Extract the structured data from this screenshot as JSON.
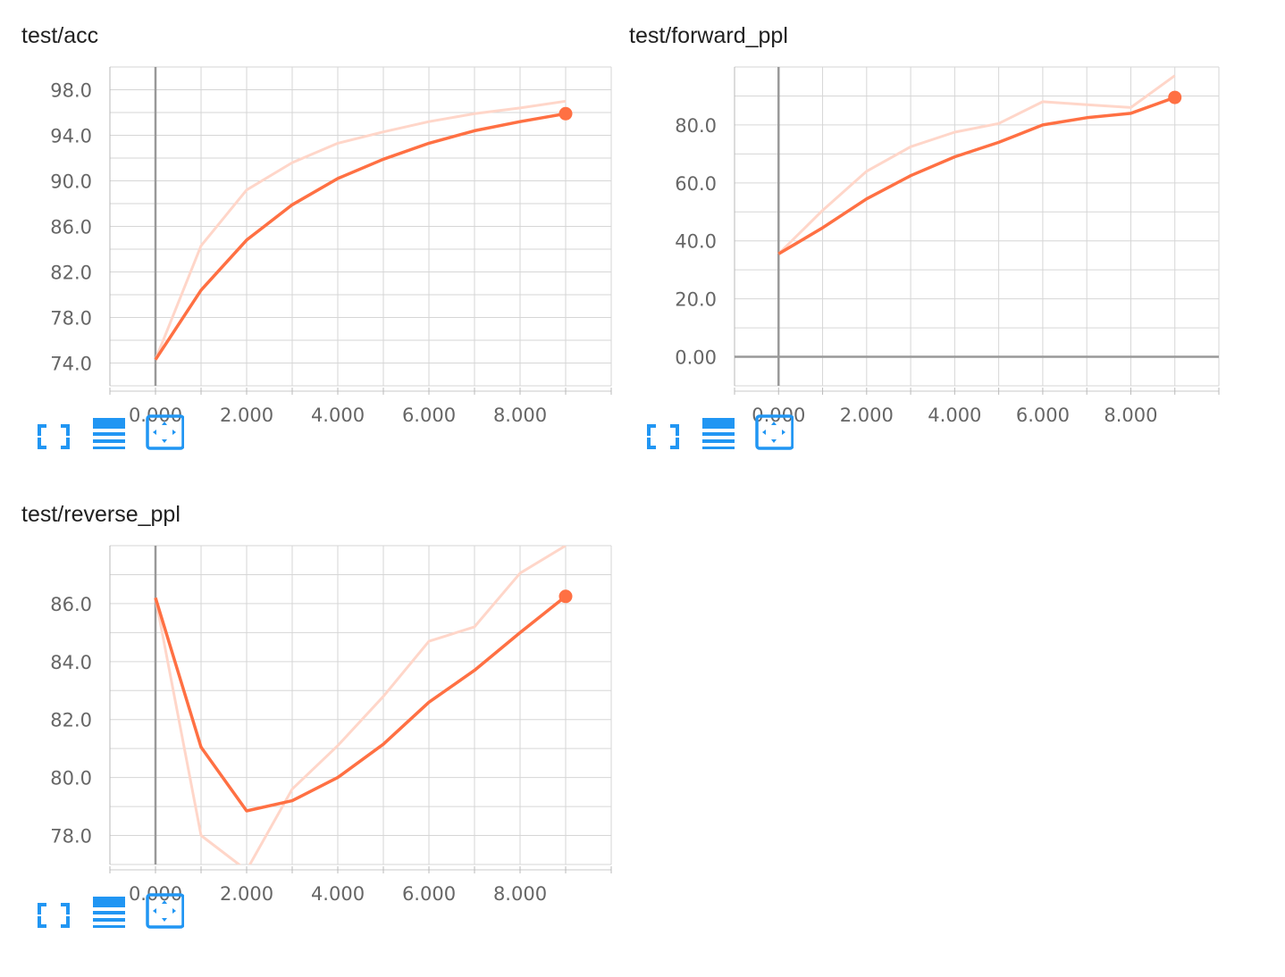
{
  "colors": {
    "line": "#ff7043",
    "line_raw": "#ffd6c9",
    "grid": "#d6d6d6",
    "axis": "#999999",
    "tick_text": "#666666",
    "toolbar_icon": "#2196f3"
  },
  "toolbar_icons": [
    "fullscreen-icon",
    "data-table-icon",
    "fit-domain-icon"
  ],
  "charts": [
    {
      "title": "test/acc",
      "chart_data": {
        "type": "line",
        "title": "test/acc",
        "x_ticks": [
          "0.000",
          "2.000",
          "4.000",
          "6.000",
          "8.000"
        ],
        "y_ticks": [
          "74.0",
          "78.0",
          "82.0",
          "86.0",
          "90.0",
          "94.0",
          "98.0"
        ],
        "xlim": [
          -1,
          10
        ],
        "ylim": [
          72,
          100
        ],
        "series": [
          {
            "values_x": [
              0,
              1,
              2,
              3,
              4,
              5,
              6,
              7,
              8,
              9
            ],
            "values": [
              74.3,
              80.4,
              84.8,
              87.9,
              90.2,
              91.9,
              93.3,
              94.4,
              95.2,
              95.9
            ]
          },
          {
            "values_x": [
              0,
              1,
              2,
              3,
              4,
              5,
              6,
              7,
              8,
              9
            ],
            "values": [
              74.3,
              84.3,
              89.2,
              91.6,
              93.3,
              94.3,
              95.2,
              95.9,
              96.4,
              97.0
            ]
          }
        ]
      }
    },
    {
      "title": "test/forward_ppl",
      "chart_data": {
        "type": "line",
        "title": "test/forward_ppl",
        "x_ticks": [
          "0.000",
          "2.000",
          "4.000",
          "6.000",
          "8.000"
        ],
        "y_ticks": [
          "0.00",
          "20.0",
          "40.0",
          "60.0",
          "80.0"
        ],
        "xlim": [
          -1,
          10
        ],
        "ylim": [
          -10,
          100
        ],
        "series": [
          {
            "values_x": [
              0,
              1,
              2,
              3,
              4,
              5,
              6,
              7,
              8,
              9
            ],
            "values": [
              35.5,
              44.5,
              54.5,
              62.5,
              69.0,
              74.0,
              80.0,
              82.5,
              84.0,
              89.5
            ]
          },
          {
            "values_x": [
              0,
              1,
              2,
              3,
              4,
              5,
              6,
              7,
              8,
              9
            ],
            "values": [
              35.5,
              50.5,
              64.0,
              72.5,
              77.5,
              80.5,
              88.0,
              87.0,
              86.0,
              97.0
            ]
          }
        ]
      }
    },
    {
      "title": "test/reverse_ppl",
      "chart_data": {
        "type": "line",
        "title": "test/reverse_ppl",
        "x_ticks": [
          "0.000",
          "2.000",
          "4.000",
          "6.000",
          "8.000"
        ],
        "y_ticks": [
          "78.0",
          "80.0",
          "82.0",
          "84.0",
          "86.0"
        ],
        "xlim": [
          -1,
          10
        ],
        "ylim": [
          77,
          88
        ],
        "series": [
          {
            "values_x": [
              0,
              1,
              2,
              3,
              4,
              5,
              6,
              7,
              8,
              9
            ],
            "values": [
              86.2,
              81.05,
              78.85,
              79.2,
              80.0,
              81.15,
              82.6,
              83.7,
              85.0,
              86.25
            ]
          },
          {
            "values_x": [
              0,
              1,
              2,
              3,
              4,
              5,
              6,
              7,
              8,
              9
            ],
            "values": [
              86.2,
              78.0,
              76.8,
              79.6,
              81.1,
              82.8,
              84.7,
              85.2,
              87.05,
              88.0
            ]
          }
        ]
      }
    }
  ]
}
